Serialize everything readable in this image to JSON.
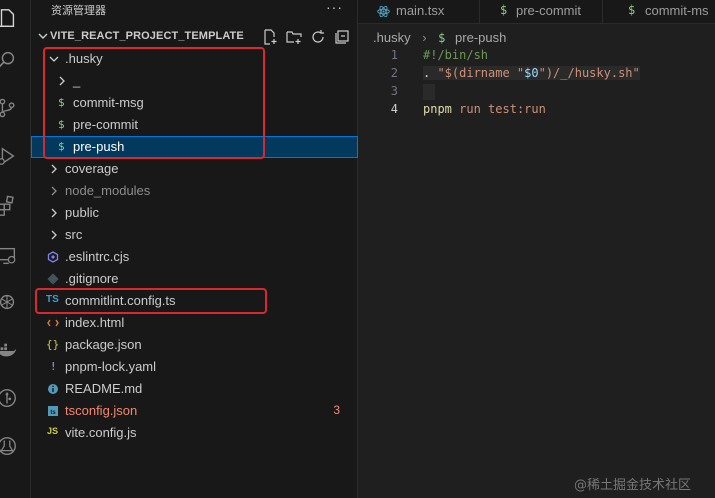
{
  "explorer": {
    "title": "资源管理器",
    "more": "···",
    "project": "VITE_REACT_PROJECT_TEMPLATE"
  },
  "tree": [
    {
      "label": ".husky",
      "kind": "folder-open",
      "depth": 0
    },
    {
      "label": "_",
      "kind": "folder",
      "depth": 1
    },
    {
      "label": "commit-msg",
      "kind": "shell",
      "depth": 1,
      "icon": "$"
    },
    {
      "label": "pre-commit",
      "kind": "shell",
      "depth": 1,
      "icon": "$"
    },
    {
      "label": "pre-push",
      "kind": "shell",
      "depth": 1,
      "icon": "$",
      "selected": true
    },
    {
      "label": "coverage",
      "kind": "folder",
      "depth": 0
    },
    {
      "label": "node_modules",
      "kind": "folder",
      "depth": 0,
      "dim": true
    },
    {
      "label": "public",
      "kind": "folder",
      "depth": 0
    },
    {
      "label": "src",
      "kind": "folder",
      "depth": 0
    },
    {
      "label": ".eslintrc.cjs",
      "kind": "eslint",
      "depth": 0
    },
    {
      "label": ".gitignore",
      "kind": "git",
      "depth": 0
    },
    {
      "label": "commitlint.config.ts",
      "kind": "ts",
      "depth": 0,
      "icon": "TS"
    },
    {
      "label": "index.html",
      "kind": "html",
      "depth": 0
    },
    {
      "label": "package.json",
      "kind": "json",
      "depth": 0,
      "icon": "{}"
    },
    {
      "label": "pnpm-lock.yaml",
      "kind": "yaml",
      "depth": 0,
      "icon": "!"
    },
    {
      "label": "README.md",
      "kind": "md",
      "depth": 0
    },
    {
      "label": "tsconfig.json",
      "kind": "tsconfig",
      "depth": 0,
      "error": true,
      "badge": "3"
    },
    {
      "label": "vite.config.js",
      "kind": "js",
      "depth": 0,
      "icon": "JS"
    }
  ],
  "tabs": [
    {
      "label": "main.tsx",
      "icon": "react-icon"
    },
    {
      "label": "pre-commit",
      "icon": "$"
    },
    {
      "label": "commit-ms",
      "icon": "$"
    }
  ],
  "breadcrumb": {
    "folder": ".husky",
    "sep": "›",
    "icon": "$",
    "file": "pre-push"
  },
  "code": [
    {
      "n": "1",
      "text": "#!/bin/sh"
    },
    {
      "n": "2",
      "text": ". \"$(dirname \"$0\")/_/husky.sh\""
    },
    {
      "n": "3",
      "text": ""
    },
    {
      "n": "4",
      "text": "pnpm run test:run"
    }
  ],
  "watermark": "@稀土掘金技术社区",
  "colors": {
    "bg": "#1f1f1f",
    "sidebar": "#181818",
    "selection": "#04395e",
    "focus": "#0078d4",
    "shell": "#89d185",
    "ts": "#3b9ed8",
    "error": "#f48771",
    "annotation": "#d9292f"
  }
}
